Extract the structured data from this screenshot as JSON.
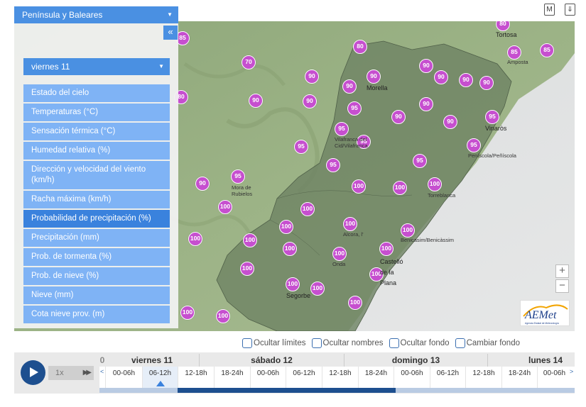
{
  "panel": {
    "region": "Península y Baleares",
    "collapse_icon": "«",
    "day": "viernes 11",
    "menu": [
      {
        "label": "Estado del cielo",
        "active": false
      },
      {
        "label": "Temperaturas (°C)",
        "active": false
      },
      {
        "label": "Sensación térmica (°C)",
        "active": false
      },
      {
        "label": "Humedad relativa (%)",
        "active": false
      },
      {
        "label": "Dirección y velocidad del viento (km/h)",
        "active": false
      },
      {
        "label": "Racha máxima (km/h)",
        "active": false
      },
      {
        "label": "Probabilidad de precipitación (%)",
        "active": true
      },
      {
        "label": "Precipitación (mm)",
        "active": false
      },
      {
        "label": "Prob. de tormenta (%)",
        "active": false
      },
      {
        "label": "Prob. de nieve (%)",
        "active": false
      },
      {
        "label": "Nieve (mm)",
        "active": false
      },
      {
        "label": "Cota nieve prov. (m)",
        "active": false
      }
    ]
  },
  "map": {
    "markers": [
      "85",
      "80",
      "85",
      "85",
      "70",
      "80",
      "90",
      "90",
      "90",
      "90",
      "90",
      "90",
      "90",
      "90",
      "80",
      "90",
      "90",
      "95",
      "90",
      "95",
      "90",
      "90",
      "95",
      "95",
      "95",
      "95",
      "95",
      "95",
      "90",
      "100",
      "95",
      "100",
      "100",
      "100",
      "100",
      "100",
      "100",
      "100",
      "100",
      "100",
      "100",
      "100",
      "100",
      "100",
      "100",
      "100",
      "100",
      "100",
      "100",
      "100"
    ],
    "places": [
      {
        "name": "Tortosa",
        "small": false
      },
      {
        "name": "Amposta",
        "small": true
      },
      {
        "name": "Morella",
        "small": false
      },
      {
        "name": "Vinaròs",
        "small": false
      },
      {
        "name": "Vilafranca del Cid/Vilafranca",
        "small": true
      },
      {
        "name": "Peníscola/Peñíscola",
        "small": true
      },
      {
        "name": "Mora de Rubielos",
        "small": true
      },
      {
        "name": "Torreblanca",
        "small": true
      },
      {
        "name": "Alcora, l'",
        "small": true
      },
      {
        "name": "Benicasim/Benicàssim",
        "small": true
      },
      {
        "name": "Onda",
        "small": true
      },
      {
        "name": "Castelló de la Plana",
        "small": false
      },
      {
        "name": "Segorbe",
        "small": false
      }
    ],
    "zoom_in": "+",
    "zoom_out": "−",
    "logo_text": "AEMet",
    "logo_sub": "Agencia Estatal de Meteorología"
  },
  "toggles": [
    "Ocultar límites",
    "Ocultar nombres",
    "Ocultar fondo",
    "Cambiar fondo"
  ],
  "timeline": {
    "speed": "1x",
    "fast_forward_icon": "▶▶",
    "leading_digit": "0",
    "days": [
      "viernes 11",
      "sábado 12",
      "domingo 13",
      "lunes 14"
    ],
    "slots": [
      "00-06h",
      "06-12h",
      "12-18h",
      "18-24h",
      "00-06h",
      "06-12h",
      "12-18h",
      "18-24h",
      "00-06h",
      "06-12h",
      "12-18h",
      "18-24h",
      "00-06h"
    ],
    "active_slot": 1,
    "progress_percent": 55
  },
  "top_icons": [
    "M",
    "⇓"
  ]
}
